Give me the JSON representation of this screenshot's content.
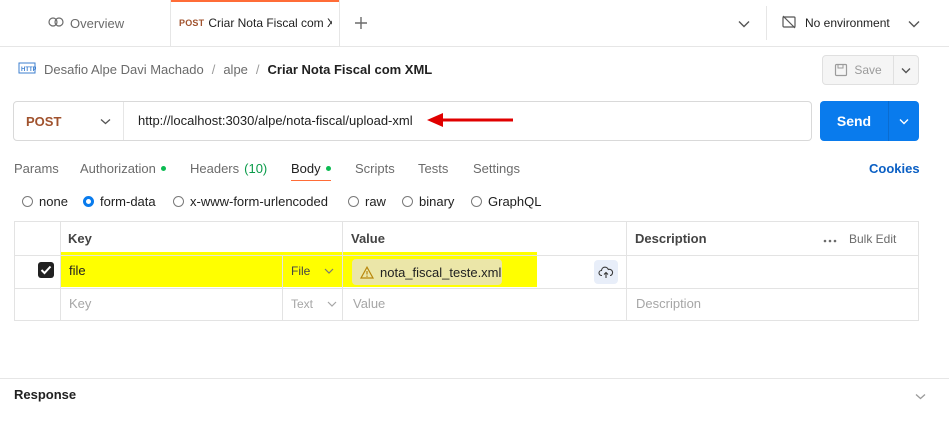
{
  "tabs": {
    "overview_label": "Overview",
    "active": {
      "method": "POST",
      "title": "Criar Nota Fiscal com X"
    }
  },
  "environment": {
    "label": "No environment"
  },
  "breadcrumb": {
    "items": [
      "Desafio Alpe Davi Machado",
      "alpe"
    ],
    "separator": "/",
    "current": "Criar Nota Fiscal com XML"
  },
  "toolbar": {
    "save_label": "Save",
    "send_label": "Send"
  },
  "request": {
    "method": "POST",
    "url": "http://localhost:3030/alpe/nota-fiscal/upload-xml"
  },
  "request_tabs": {
    "params": "Params",
    "authorization": "Authorization",
    "headers": "Headers",
    "headers_count": "(10)",
    "body": "Body",
    "scripts": "Scripts",
    "tests": "Tests",
    "settings": "Settings",
    "cookies": "Cookies"
  },
  "body_types": {
    "none": "none",
    "form_data": "form-data",
    "urlencoded": "x-www-form-urlencoded",
    "raw": "raw",
    "binary": "binary",
    "graphql": "GraphQL",
    "selected": "form-data"
  },
  "table": {
    "headers": {
      "key": "Key",
      "value": "Value",
      "description": "Description",
      "bulk_edit": "Bulk Edit"
    },
    "rows": [
      {
        "checked": true,
        "key": "file",
        "type": "File",
        "value": "nota_fiscal_teste.xml",
        "description": ""
      }
    ],
    "placeholder": {
      "key": "Key",
      "type": "Text",
      "value": "Value",
      "description": "Description"
    }
  },
  "response": {
    "title": "Response"
  },
  "colors": {
    "accent": "#ff6c37",
    "send": "#097bed",
    "method_post": "#a0522d",
    "highlight": "#ffff00",
    "arrow": "#e00000",
    "status_dot": "#0cbb52"
  }
}
